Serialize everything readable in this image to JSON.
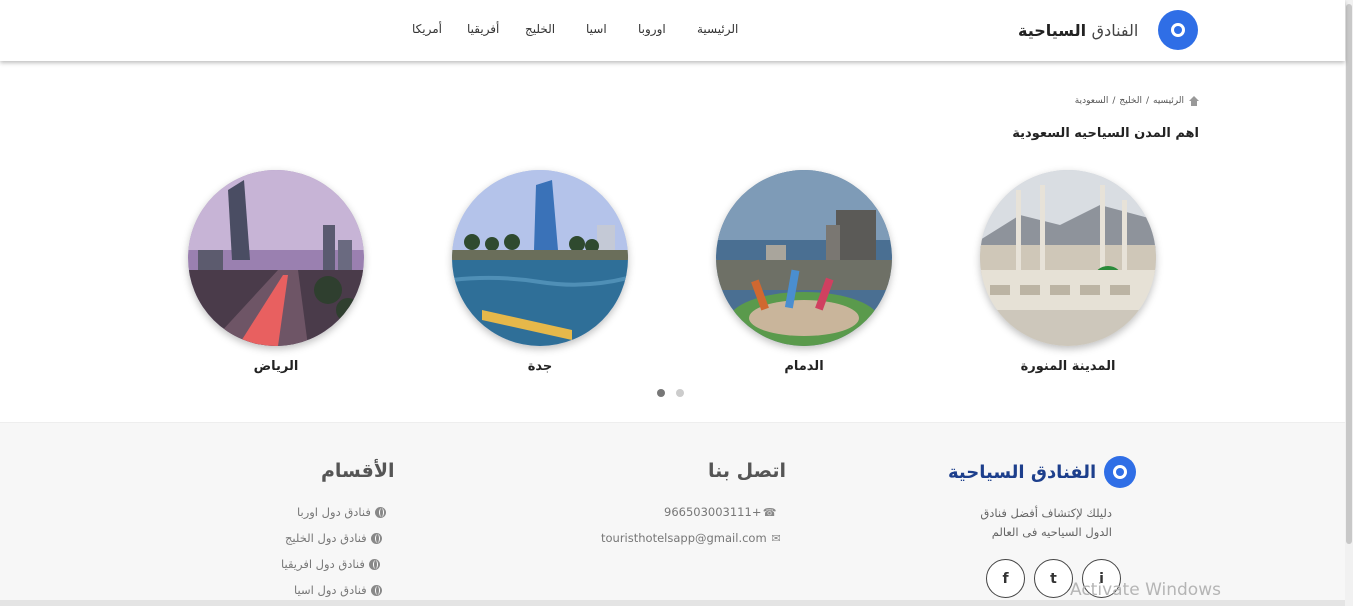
{
  "header": {
    "logo_bold": "الفنادق",
    "logo_light": "السياحية",
    "nav": [
      "الرئيسية",
      "اوروبا",
      "اسيا",
      "الخليج",
      "أفريقيا",
      "أمريكا"
    ]
  },
  "breadcrumb": {
    "home": "الرئيسيه",
    "sep1": "/",
    "gulf": "الخليج",
    "sep2": "/",
    "current": "السعودية"
  },
  "section": {
    "title": "اهم المدن السياحيه السعودية"
  },
  "cities": [
    "المدينة المنورة",
    "الدمام",
    "جدة",
    "الرياض"
  ],
  "carousel": {
    "slides": 2,
    "active": 1
  },
  "footer": {
    "brand": "الفنادق السياحية",
    "description_1": "دليلك لإكتشاف أفضل فنادق",
    "description_2": "الدول السياحيه فى العالم",
    "social": [
      "f",
      "t",
      "i"
    ],
    "contact_heading": "اتصل بنا",
    "phone": "+966503003111",
    "email": "touristhotelsapp@gmail.com",
    "sections_heading": "الأقسام",
    "sections": [
      "فنادق دول اوربا",
      "فنادق دول الخليج",
      "فنادق دول افريقيا",
      "فنادق دول اسيا"
    ]
  },
  "watermark": "Activate Windows",
  "colors": {
    "brand": "#2f6ee6",
    "brand_dark": "#1d3f8c"
  }
}
